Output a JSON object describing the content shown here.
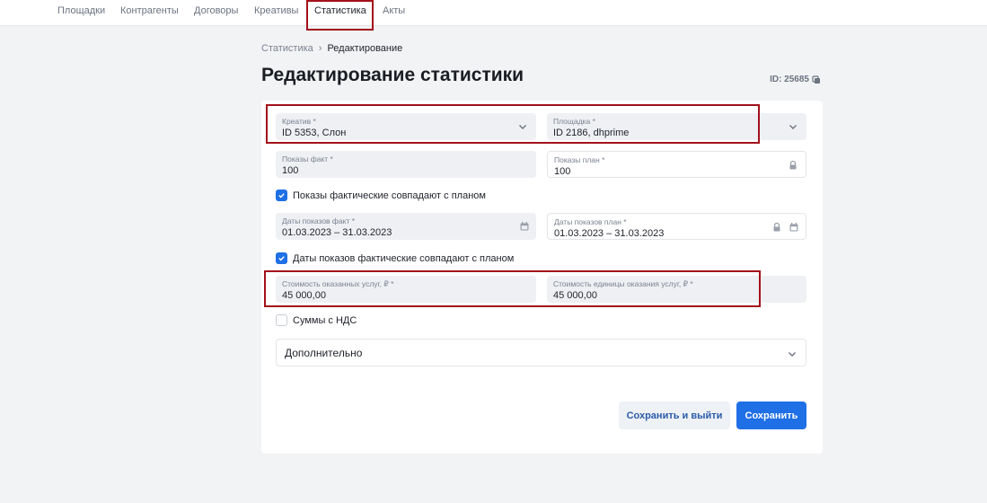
{
  "nav": {
    "items": [
      {
        "label": "Площадки"
      },
      {
        "label": "Контрагенты"
      },
      {
        "label": "Договоры"
      },
      {
        "label": "Креативы"
      },
      {
        "label": "Статистика"
      },
      {
        "label": "Акты"
      }
    ],
    "active": "Статистика"
  },
  "breadcrumb": {
    "parent": "Статистика",
    "current": "Редактирование"
  },
  "page": {
    "title": "Редактирование статистики",
    "id_text": "ID: 25685"
  },
  "form": {
    "creative": {
      "label": "Креатив *",
      "value": "ID 5353, Слон"
    },
    "platform": {
      "label": "Площадка *",
      "value": "ID 2186, dhprime"
    },
    "impressions_fact": {
      "label": "Показы факт *",
      "value": "100"
    },
    "impressions_plan": {
      "label": "Показы план *",
      "value": "100"
    },
    "impressions_match": {
      "label": "Показы фактические совпадают с планом",
      "checked": true
    },
    "dates_fact": {
      "label": "Даты показов факт *",
      "value": "01.03.2023 – 31.03.2023"
    },
    "dates_plan": {
      "label": "Даты показов план *",
      "value": "01.03.2023 – 31.03.2023"
    },
    "dates_match": {
      "label": "Даты показов фактические совпадают с планом",
      "checked": true
    },
    "cost_total": {
      "label": "Стоимость оказанных услуг, ₽ *",
      "value": "45 000,00"
    },
    "cost_unit": {
      "label": "Стоимость единицы оказания услуг, ₽ *",
      "value": "45 000,00"
    },
    "vat": {
      "label": "Суммы с НДС",
      "checked": false
    },
    "additional": {
      "label": "Дополнительно"
    }
  },
  "actions": {
    "save_exit": "Сохранить и выйти",
    "save": "Сохранить"
  },
  "colors": {
    "primary": "#1f6fe6",
    "highlight": "#a3101b",
    "field_bg": "#eef0f3"
  },
  "icons": [
    "chevron-down-icon",
    "lock-icon",
    "calendar-icon",
    "check-icon",
    "copy-icon",
    "breadcrumb-chevron-icon"
  ]
}
